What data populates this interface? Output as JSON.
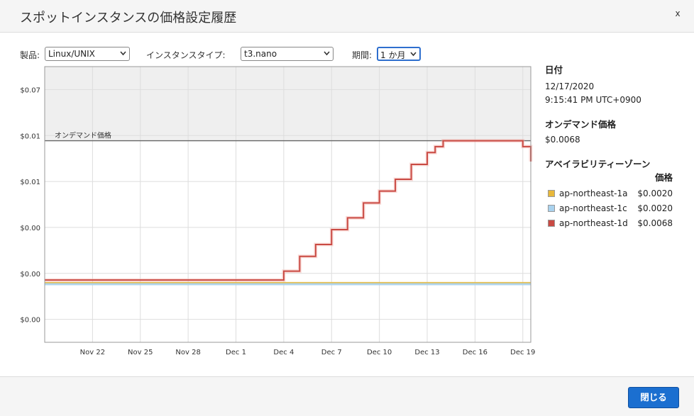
{
  "dialog": {
    "title": "スポットインスタンスの価格設定履歴",
    "close_glyph": "x"
  },
  "filters": {
    "product_label": "製品:",
    "product_value": "Linux/UNIX",
    "type_label": "インスタンスタイプ:",
    "type_value": "t3.nano",
    "period_label": "期間:",
    "period_value": "1 か月"
  },
  "chart_data": {
    "type": "line",
    "y_tick_labels": [
      "$0.07",
      "$0.01",
      "$0.01",
      "$0.00",
      "$0.00",
      "$0.00"
    ],
    "x_tick_labels": [
      "Nov 22",
      "Nov 25",
      "Nov 28",
      "Dec 1",
      "Dec 4",
      "Dec 7",
      "Dec 10",
      "Dec 13",
      "Dec 16",
      "Dec 19"
    ],
    "x": [
      "Nov 19",
      "Dec 3.7",
      "Dec 4",
      "Dec 5",
      "Dec 6",
      "Dec 7",
      "Dec 8",
      "Dec 9",
      "Dec 10",
      "Dec 11",
      "Dec 12",
      "Dec 13",
      "Dec 13.5",
      "Dec 14",
      "Dec 14.5",
      "Dec 18.5",
      "Dec 19",
      "Dec 19.5"
    ],
    "ylim": [
      0.0,
      0.0093
    ],
    "on_demand": {
      "label": "オンデマンド価格",
      "value": 0.0068
    },
    "series": [
      {
        "name": "ap-northeast-1a",
        "color": "#e8b83a",
        "values": [
          0.002,
          0.002,
          0.002,
          0.002,
          0.002,
          0.002,
          0.002,
          0.002,
          0.002,
          0.002,
          0.002,
          0.002,
          0.002,
          0.002,
          0.002,
          0.002,
          0.002,
          0.002
        ]
      },
      {
        "name": "ap-northeast-1c",
        "color": "#a9d2ee",
        "values": [
          0.002,
          0.002,
          0.002,
          0.002,
          0.002,
          0.002,
          0.002,
          0.002,
          0.002,
          0.002,
          0.002,
          0.002,
          0.002,
          0.002,
          0.002,
          0.002,
          0.002,
          0.002
        ]
      },
      {
        "name": "ap-northeast-1d",
        "color": "#c94a43",
        "values": [
          0.0021,
          0.0021,
          0.0024,
          0.0029,
          0.0033,
          0.0038,
          0.0042,
          0.0047,
          0.0051,
          0.0055,
          0.006,
          0.0064,
          0.0066,
          0.0068,
          0.0068,
          0.0068,
          0.0066,
          0.0061
        ]
      }
    ],
    "grid": true
  },
  "side": {
    "date_heading": "日付",
    "date_value": "12/17/2020",
    "time_value": "9:15:41 PM UTC+0900",
    "ondemand_heading": "オンデマンド価格",
    "ondemand_value": "$0.0068",
    "az_heading": "アベイラビリティーゾーン",
    "price_heading": "価格",
    "rows": [
      {
        "name": "ap-northeast-1a",
        "price": "$0.0020",
        "color": "#e8b83a"
      },
      {
        "name": "ap-northeast-1c",
        "price": "$0.0020",
        "color": "#a9d2ee"
      },
      {
        "name": "ap-northeast-1d",
        "price": "$0.0068",
        "color": "#c94a43"
      }
    ]
  },
  "footer": {
    "close_label": "閉じる"
  }
}
